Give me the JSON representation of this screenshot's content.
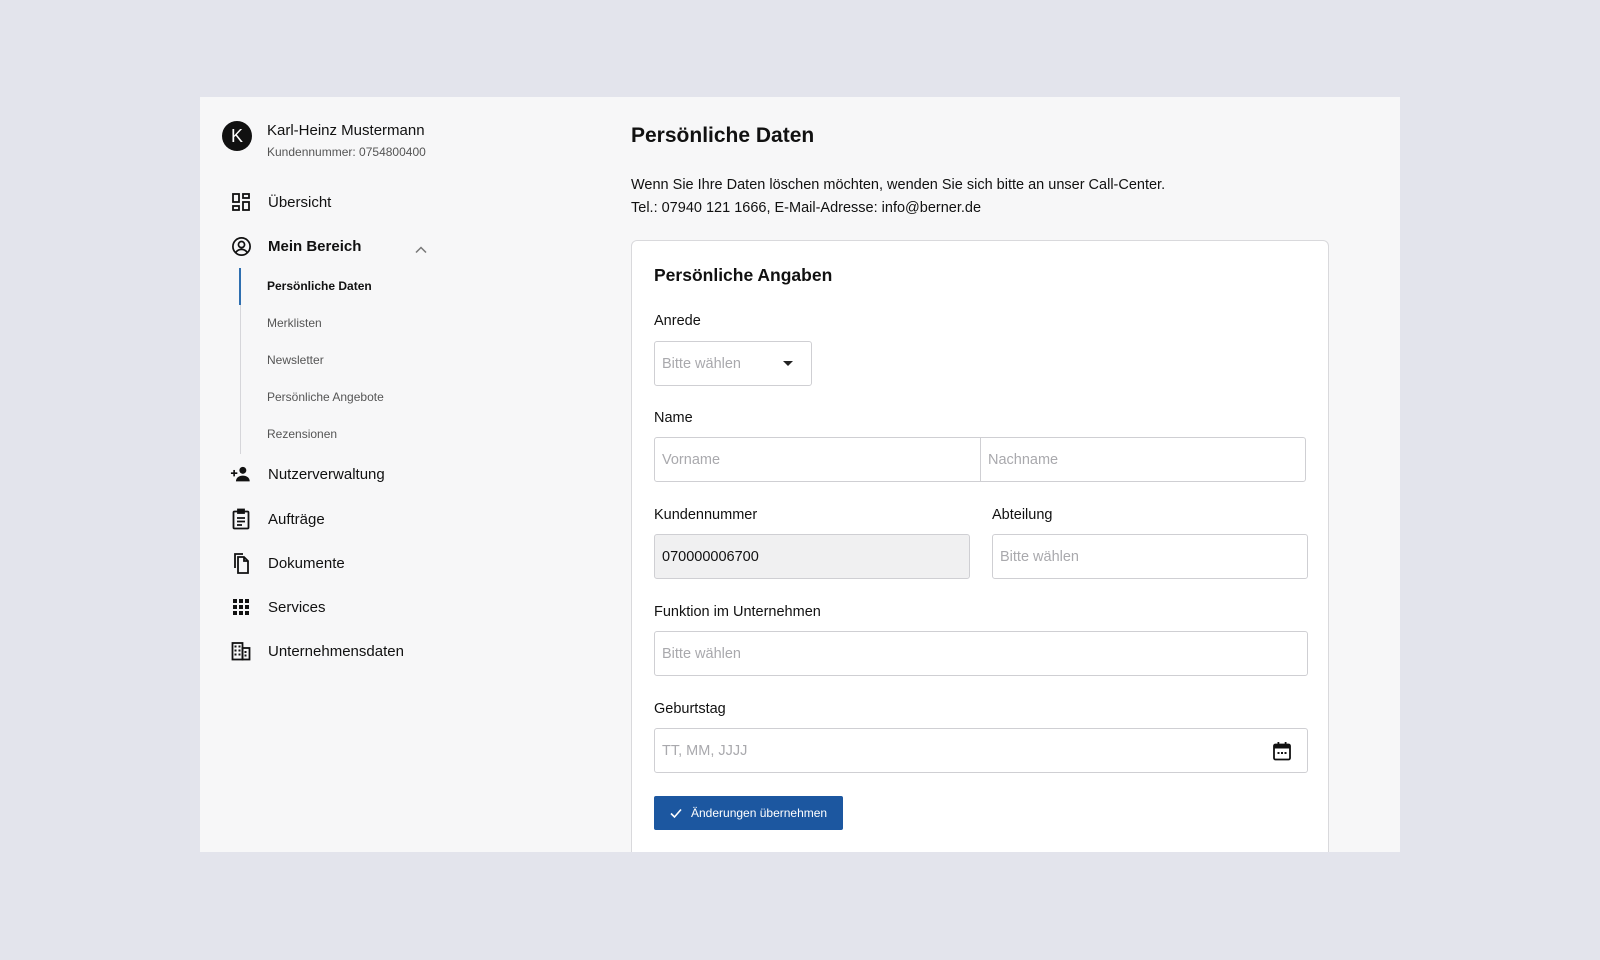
{
  "user": {
    "avatar_letter": "K",
    "name": "Karl-Heinz Mustermann",
    "customer_number_label": "Kundennummer: 0754800400"
  },
  "sidebar": {
    "items": [
      {
        "label": "Übersicht",
        "icon": "dashboard-icon"
      },
      {
        "label": "Mein Bereich",
        "icon": "account-circle-icon",
        "expanded": true
      },
      {
        "label": "Nutzerverwaltung",
        "icon": "person-add-icon"
      },
      {
        "label": "Aufträge",
        "icon": "clipboard-icon"
      },
      {
        "label": "Dokumente",
        "icon": "documents-icon"
      },
      {
        "label": "Services",
        "icon": "apps-grid-icon"
      },
      {
        "label": "Unternehmensdaten",
        "icon": "building-icon"
      }
    ],
    "sub_items": [
      {
        "label": "Persönliche Daten",
        "active": true
      },
      {
        "label": "Merklisten"
      },
      {
        "label": "Newsletter"
      },
      {
        "label": "Persönliche Angebote"
      },
      {
        "label": "Rezensionen"
      }
    ]
  },
  "main": {
    "title": "Persönliche Daten",
    "info_line1": "Wenn Sie Ihre Daten löschen möchten, wenden Sie sich bitte an unser Call-Center.",
    "info_line2": "Tel.: 07940 121 1666, E-Mail-Adresse: info@berner.de"
  },
  "form": {
    "title": "Persönliche Angaben",
    "salutation": {
      "label": "Anrede",
      "placeholder": "Bitte wählen"
    },
    "name": {
      "label": "Name",
      "first_placeholder": "Vorname",
      "last_placeholder": "Nachname"
    },
    "customer_number": {
      "label": "Kundennummer",
      "value": "070000006700"
    },
    "department": {
      "label": "Abteilung",
      "placeholder": "Bitte wählen"
    },
    "function": {
      "label": "Funktion im Unternehmen",
      "placeholder": "Bitte wählen"
    },
    "birthday": {
      "label": "Geburtstag",
      "placeholder": "TT, MM, JJJJ"
    },
    "submit_label": "Änderungen übernehmen"
  },
  "colors": {
    "page_bg": "#e3e4ec",
    "panel_bg": "#f7f7f8",
    "accent": "#1c57a0",
    "active_indicator": "#2f6fb0"
  }
}
